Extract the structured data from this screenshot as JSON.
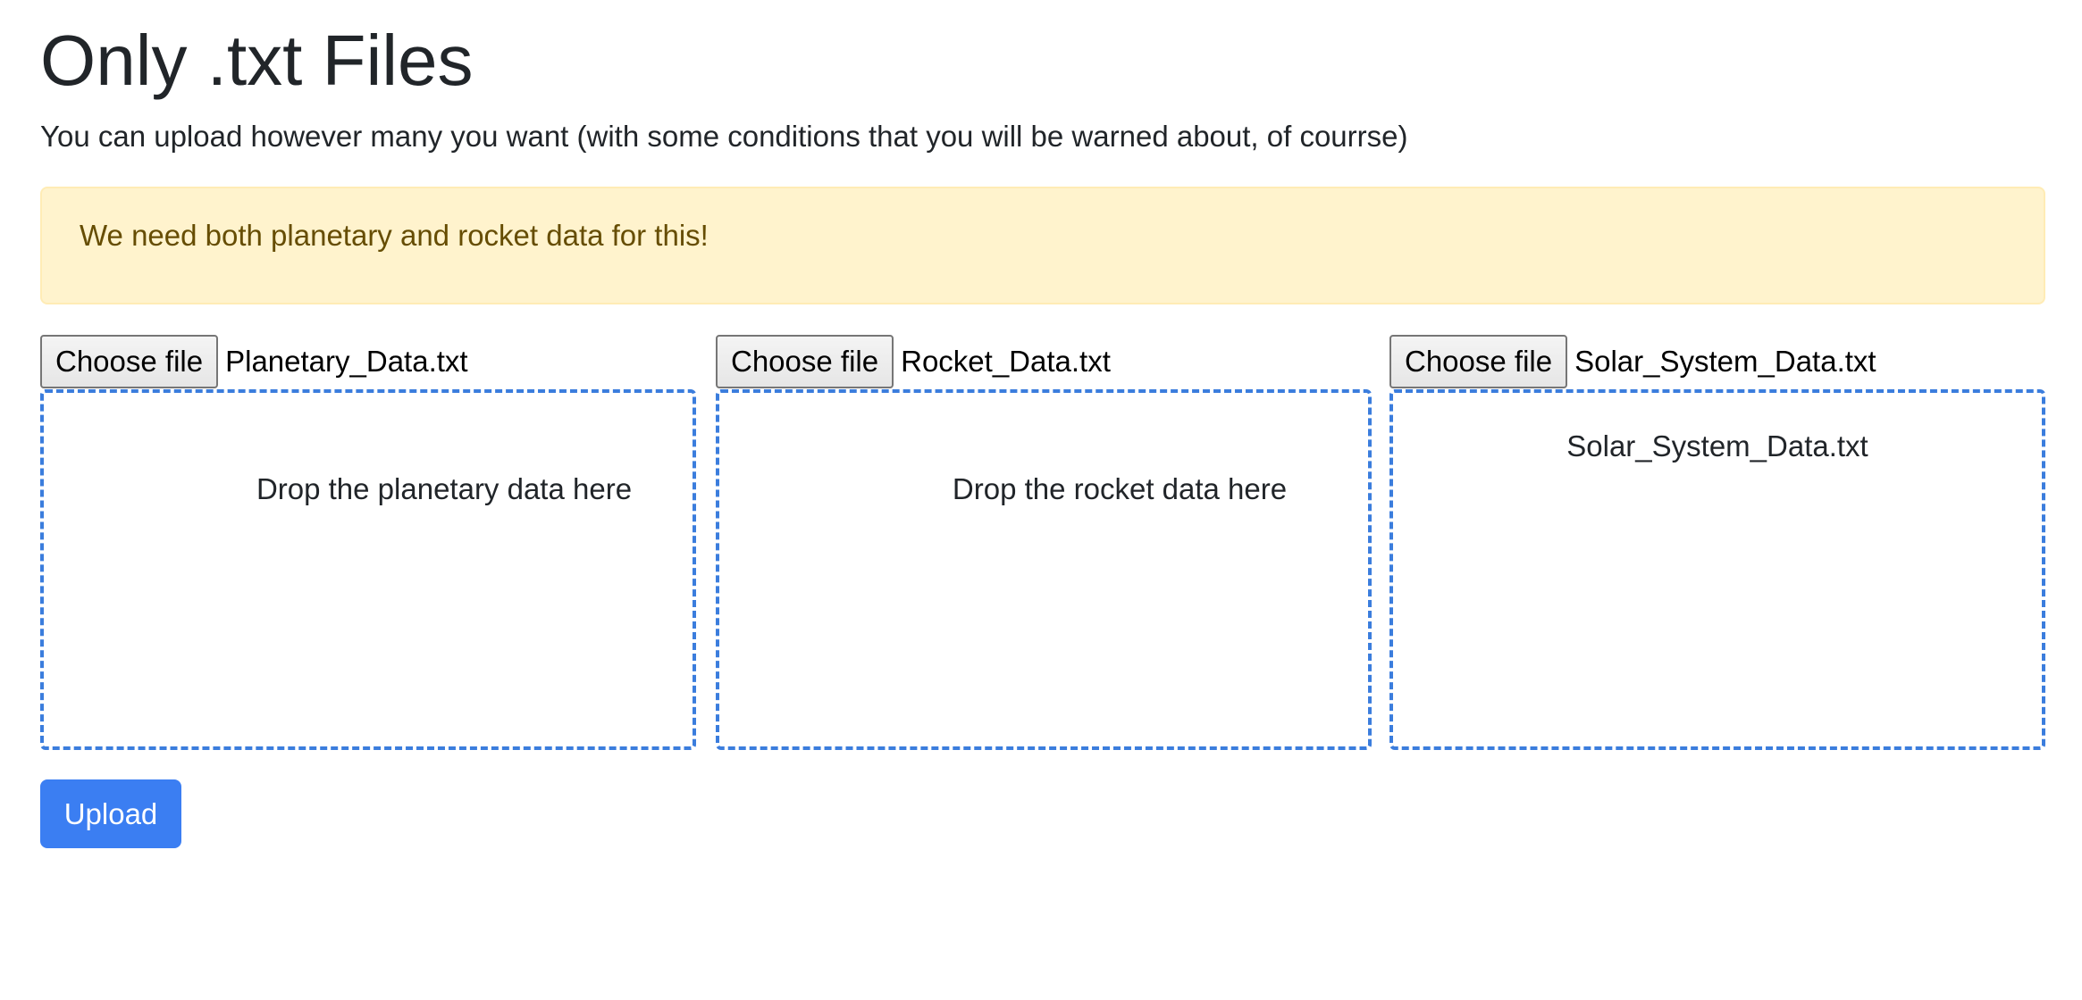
{
  "page": {
    "title": "Only .txt Files",
    "subtitle": "You can upload however many you want (with some conditions that you will be warned about, of courrse)"
  },
  "alert": {
    "message": "We need both planetary and rocket data for this!",
    "colors": {
      "background": "#fff3cd",
      "text": "#664d03"
    }
  },
  "uploaders": [
    {
      "choose_label": "Choose file",
      "file_name": "Planetary_Data.txt",
      "dropzone_text": "Drop the planetary data here"
    },
    {
      "choose_label": "Choose file",
      "file_name": "Rocket_Data.txt",
      "dropzone_text": "Drop the rocket data here"
    },
    {
      "choose_label": "Choose file",
      "file_name": "Solar_System_Data.txt",
      "dropzone_text": "Solar_System_Data.txt"
    }
  ],
  "upload_button": {
    "label": "Upload",
    "color": "#3b7ef2"
  },
  "dropzone_border_color": "#3b7ddd"
}
